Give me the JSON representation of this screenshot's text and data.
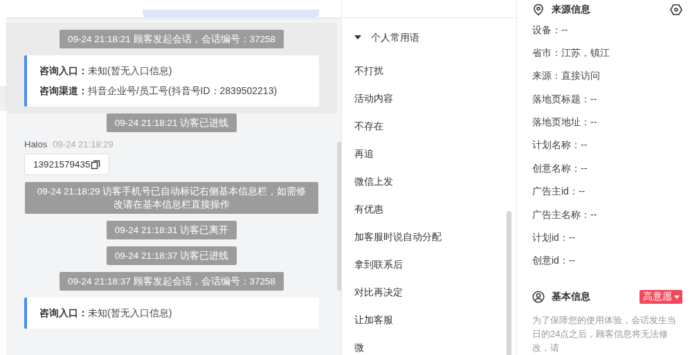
{
  "chat": {
    "items": [
      {
        "kind": "system",
        "highlighted": true,
        "text": "09-24 21:18:21 顾客发起会话，会话编号：37258"
      },
      {
        "kind": "entry_card",
        "highlighted": true,
        "lines": [
          {
            "label": "咨询入口：",
            "value": "未知(暂无入口信息)"
          },
          {
            "label": "咨询渠道：",
            "value": "抖音企业号/员工号(抖音号ID：2839502213)"
          }
        ]
      },
      {
        "kind": "system",
        "highlighted": false,
        "text": "09-24 21:18:21 访客已进线"
      },
      {
        "kind": "message",
        "highlighted": false,
        "sender": "Halos",
        "time": "09-24 21:18:29",
        "text": "13921579435"
      },
      {
        "kind": "system",
        "highlighted": false,
        "text": "09-24 21:18:29 访客手机号已自动标记右侧基本信息栏，如需修改请在基本信息栏直接操作"
      },
      {
        "kind": "system",
        "highlighted": false,
        "text": "09-24 21:18:31 访客已离开"
      },
      {
        "kind": "system",
        "highlighted": false,
        "text": "09-24 21:18:37 访客已进线"
      },
      {
        "kind": "system",
        "highlighted": false,
        "text": "09-24 21:18:37 顾客发起会话，会话编号：37258"
      },
      {
        "kind": "entry_card",
        "highlighted": false,
        "lines": [
          {
            "label": "咨询入口：",
            "value": "未知(暂无入口信息)"
          }
        ]
      }
    ]
  },
  "phrases": {
    "group": {
      "title": "个人常用语",
      "expanded": true
    },
    "items": [
      "不打扰",
      "活动内容",
      "不存在",
      "再追",
      "微信上发",
      "有优惠",
      "加客服时说自动分配",
      "拿到联系后",
      "对比再决定",
      "让加客服",
      "微"
    ]
  },
  "source_info": {
    "title": "来源信息",
    "fields": [
      "设备：--",
      "省市：江苏，镇江",
      "来源：直接访问",
      "落地页标题：--",
      "落地页地址：--",
      "计划名称：--",
      "创意名称：--",
      "广告主id：--",
      "广告主名称：--",
      "计划id：--",
      "创意id：--"
    ]
  },
  "basic_info": {
    "title": "基本信息",
    "intent_tag": "高意愿",
    "note": "为了保障您的使用体验，会话发生当日的24点之后，顾客信息将无法修改，请"
  }
}
